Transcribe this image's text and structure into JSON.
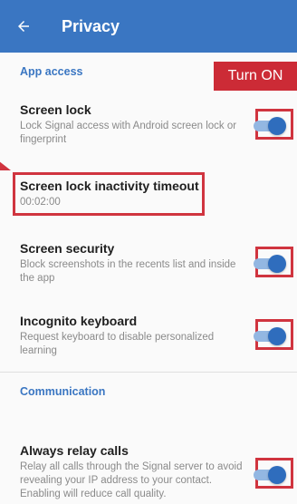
{
  "appbar": {
    "back_icon": "arrow-back-icon",
    "title": "Privacy"
  },
  "sections": {
    "app_access": "App access",
    "communication": "Communication"
  },
  "callout": {
    "label": "Turn ON"
  },
  "items": {
    "screen_lock": {
      "title": "Screen lock",
      "summary": "Lock Signal access with Android screen lock or fingerprint",
      "toggle_on": true
    },
    "inactivity_timeout": {
      "title": "Screen lock inactivity timeout",
      "value": "00:02:00"
    },
    "screen_security": {
      "title": "Screen security",
      "summary": "Block screenshots in the recents list and inside the app",
      "toggle_on": true
    },
    "incognito_keyboard": {
      "title": "Incognito keyboard",
      "summary": "Request keyboard to disable personalized learning",
      "toggle_on": true
    },
    "always_relay_calls": {
      "title": "Always relay calls",
      "summary": "Relay all calls through the Signal server to avoid revealing your IP address to your contact. Enabling will reduce call quality.",
      "toggle_on": true
    }
  },
  "colors": {
    "appbar": "#3a76c2",
    "section_header": "#3a76c2",
    "toggle_thumb": "#2f6dbd",
    "toggle_track": "#93b7e2",
    "annotation_red": "#d0343f"
  }
}
